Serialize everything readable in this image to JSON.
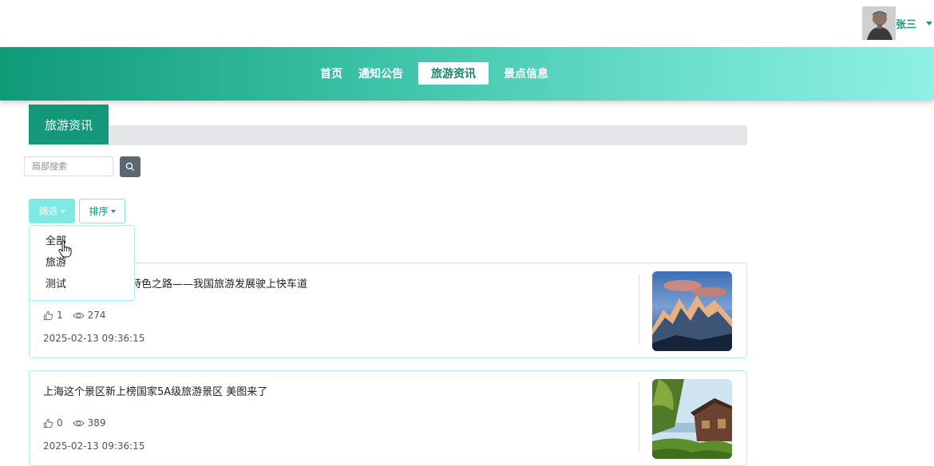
{
  "user": {
    "name": "张三"
  },
  "nav": {
    "items": [
      {
        "label": "首页",
        "active": false
      },
      {
        "label": "通知公告",
        "active": false
      },
      {
        "label": "旅游资讯",
        "active": true
      },
      {
        "label": "景点信息",
        "active": false
      }
    ]
  },
  "section": {
    "title": "旅游资讯"
  },
  "search": {
    "placeholder": "局部搜索"
  },
  "toolbar": {
    "filter_label": "筛选",
    "sort_label": "排序"
  },
  "dropdown": {
    "options": [
      "全部",
      "旅游",
      "测试"
    ]
  },
  "articles": [
    {
      "title": "特色之路——我国旅游发展驶上快车道",
      "likes": "1",
      "views": "274",
      "date": "2025-02-13 09:36:15",
      "image": "mountain-sunset"
    },
    {
      "title": "上海这个景区新上榜国家5A级旅游景区 美图来了",
      "likes": "0",
      "views": "389",
      "date": "2025-02-13 09:36:15",
      "image": "lakeside-cabin"
    }
  ],
  "colors": {
    "accent": "#13997a",
    "nav_start": "#0f9a78",
    "nav_end": "#8ff0e6",
    "filter_bg": "#7fe9e3",
    "card_border": "#aeeef0"
  }
}
